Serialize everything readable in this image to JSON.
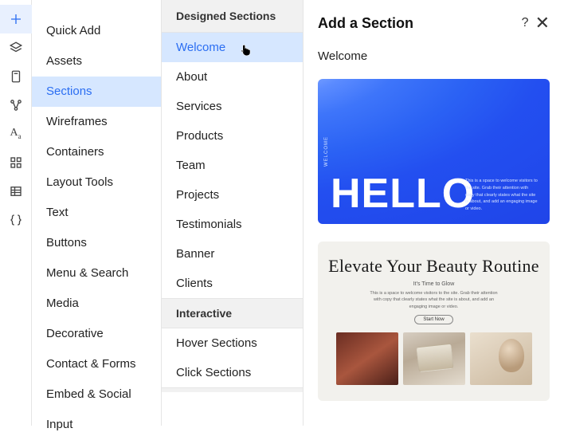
{
  "rail": {
    "icons": [
      "plus",
      "layers",
      "page",
      "node",
      "type",
      "grid",
      "table",
      "braces"
    ]
  },
  "categories": {
    "items": [
      "Quick Add",
      "Assets",
      "Sections",
      "Wireframes",
      "Containers",
      "Layout Tools",
      "Text",
      "Buttons",
      "Menu & Search",
      "Media",
      "Decorative",
      "Contact & Forms",
      "Embed & Social",
      "Input"
    ],
    "active_index": 2
  },
  "subcats": {
    "groups": [
      {
        "header": "Designed Sections",
        "items": [
          "Welcome",
          "About",
          "Services",
          "Products",
          "Team",
          "Projects",
          "Testimonials",
          "Banner",
          "Clients"
        ],
        "active_index": 0
      },
      {
        "header": "Interactive",
        "items": [
          "Hover Sections",
          "Click Sections"
        ]
      }
    ]
  },
  "panel": {
    "title": "Add a Section",
    "help_glyph": "?",
    "close_glyph": "✕",
    "section_name": "Welcome",
    "previews": {
      "hello": {
        "vertical_label": "WELCOME",
        "big_text": "HELLO",
        "small_text": "This is a space to welcome visitors to the site. Grab their attention with copy that clearly states what the site is about, and add an engaging image or video."
      },
      "beauty": {
        "headline": "Elevate Your Beauty Routine",
        "sub1": "It's Time to Glow",
        "sub2": "This is a space to welcome visitors to the site. Grab their attention with copy that clearly states what the site is about, and add an engaging image or video.",
        "button": "Start Now"
      }
    }
  }
}
